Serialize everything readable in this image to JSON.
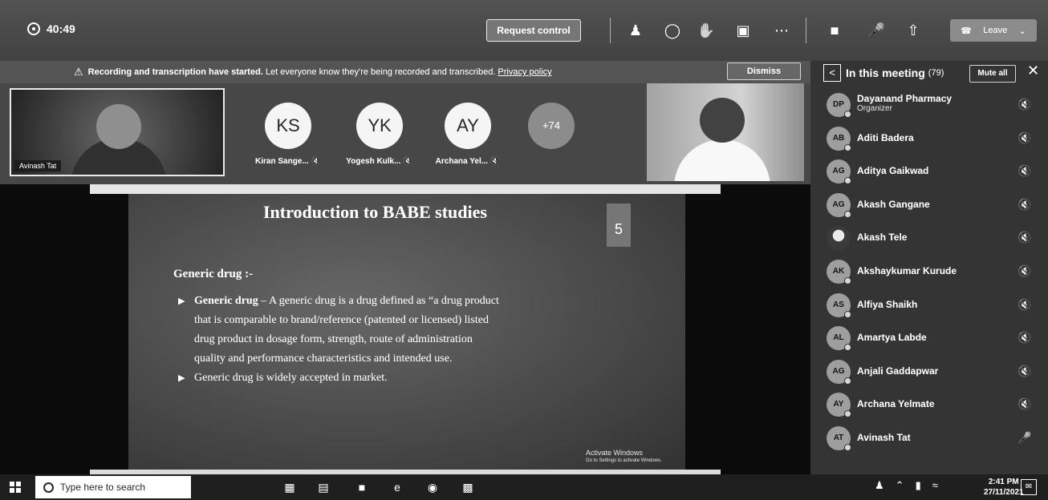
{
  "toolbar": {
    "timer": "40:49",
    "request_control": "Request control",
    "leave": "Leave"
  },
  "notice": {
    "bold_text": "Recording and transcription have started.",
    "text": "Let everyone know they're being recorded and transcribed.",
    "link": "Privacy policy",
    "dismiss": "Dismiss"
  },
  "strip": {
    "tile_name": "Avinash Tat",
    "avatars": [
      {
        "initials": "KS",
        "label": "Kiran Sange..."
      },
      {
        "initials": "YK",
        "label": "Yogesh Kulk..."
      },
      {
        "initials": "AY",
        "label": "Archana Yel..."
      },
      {
        "initials": "+74",
        "label": ""
      }
    ]
  },
  "slide": {
    "title": "Introduction to BABE studies",
    "number": "5",
    "subtitle": "Generic drug :-",
    "bullet1_bold": "Generic drug",
    "bullet1_line1": " – A generic drug is a drug defined as “a drug product",
    "bullet1_line2": "that is comparable to brand/reference (patented or licensed) listed",
    "bullet1_line3": "drug product in dosage form, strength, route of administration",
    "bullet1_line4": "quality and performance characteristics and intended use.",
    "bullet2": "Generic drug is widely accepted in market.",
    "watermark_1": "Activate Windows",
    "watermark_2": "Go to Settings to activate Windows."
  },
  "panel": {
    "title": "In this meeting",
    "count": "(79)",
    "mute_all": "Mute all",
    "participants": [
      {
        "initials": "DP",
        "name": "Dayanand Pharmacy",
        "role": "Organizer"
      },
      {
        "initials": "AB",
        "name": "Aditi Badera",
        "role": ""
      },
      {
        "initials": "AG",
        "name": "Aditya Gaikwad",
        "role": ""
      },
      {
        "initials": "AG",
        "name": "Akash Gangane",
        "role": ""
      },
      {
        "initials": "",
        "name": "Akash Tele",
        "role": ""
      },
      {
        "initials": "AK",
        "name": "Akshaykumar Kurude",
        "role": ""
      },
      {
        "initials": "AS",
        "name": "Alfiya Shaikh",
        "role": ""
      },
      {
        "initials": "AL",
        "name": "Amartya Labde",
        "role": ""
      },
      {
        "initials": "AG",
        "name": "Anjali Gaddapwar",
        "role": ""
      },
      {
        "initials": "AY",
        "name": "Archana Yelmate",
        "role": ""
      },
      {
        "initials": "AT",
        "name": "Avinash Tat",
        "role": ""
      }
    ]
  },
  "taskbar": {
    "search_placeholder": "Type here to search",
    "time": "2:41 PM",
    "date": "27/11/2021"
  },
  "icons": [
    "shield-icon",
    "people-icon",
    "chat-icon",
    "reactions-icon",
    "rooms-icon",
    "more-icon",
    "camera-icon",
    "mic-off-icon",
    "share-icon",
    "phone-icon",
    "windows-icon",
    "search-icon",
    "edge-icon",
    "chrome-icon",
    "teams-icon",
    "mic-muted-icon"
  ]
}
